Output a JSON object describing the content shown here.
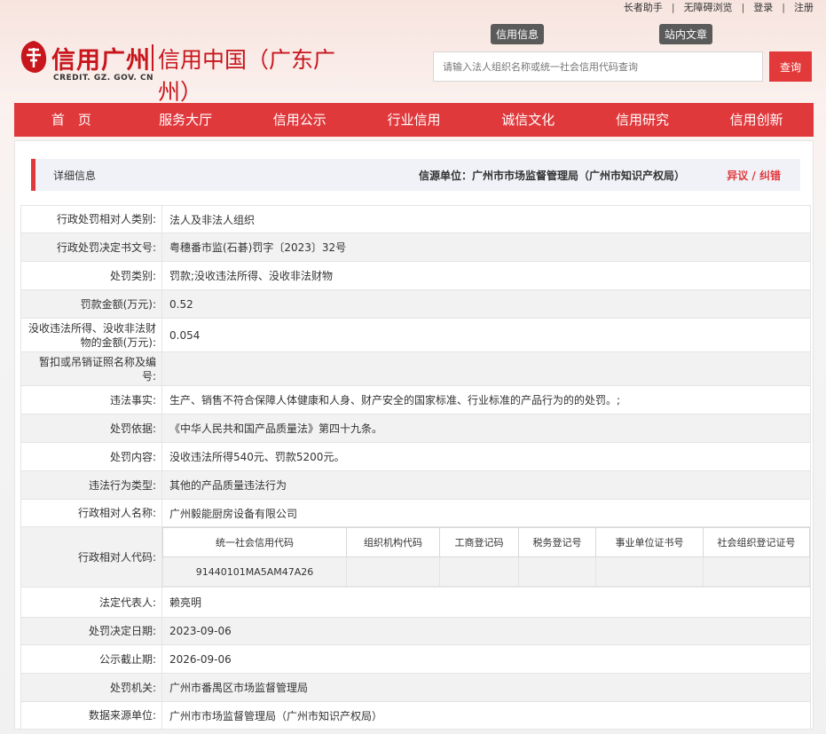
{
  "top_links": [
    "长者助手",
    "无障碍浏览",
    "登录",
    "注册"
  ],
  "logo": {
    "title": "信用广州",
    "subtitle": "信用中国（广东广州）",
    "domain": "CREDIT. GZ. GOV. CN"
  },
  "search": {
    "tab_info": "信用信息",
    "tab_articles": "站内文章",
    "placeholder": "请输入法人组织名称或统一社会信用代码查询",
    "button": "查询"
  },
  "nav": [
    "首　页",
    "服务大厅",
    "信用公示",
    "行业信用",
    "诚信文化",
    "信用研究",
    "信用创新"
  ],
  "detail": {
    "title": "详细信息",
    "source": "信源单位：广州市市场监督管理局（广州市知识产权局）",
    "dispute": "异议 / 纠错"
  },
  "rows": [
    {
      "label": "行政处罚相对人类别:",
      "value": "法人及非法人组织"
    },
    {
      "label": "行政处罚决定书文号:",
      "value": "粤穗番市监(石碁)罚字〔2023〕32号"
    },
    {
      "label": "处罚类别:",
      "value": "罚款;没收违法所得、没收非法财物"
    },
    {
      "label": "罚款金额(万元):",
      "value": "0.52"
    },
    {
      "label": "没收违法所得、没收非法财物的金额(万元):",
      "value": "0.054"
    },
    {
      "label": "暂扣或吊销证照名称及编号:",
      "value": ""
    },
    {
      "label": "违法事实:",
      "value": "生产、销售不符合保障人体健康和人身、财产安全的国家标准、行业标准的产品行为的的处罚。;"
    },
    {
      "label": "处罚依据:",
      "value": "《中华人民共和国产品质量法》第四十九条。"
    },
    {
      "label": "处罚内容:",
      "value": "没收违法所得540元、罚款5200元。"
    },
    {
      "label": "违法行为类型:",
      "value": "其他的产品质量违法行为"
    },
    {
      "label": "行政相对人名称:",
      "value": "广州毅能厨房设备有限公司"
    }
  ],
  "codes": {
    "label": "行政相对人代码:",
    "headers": [
      "统一社会信用代码",
      "组织机构代码",
      "工商登记码",
      "税务登记号",
      "事业单位证书号",
      "社会组织登记证号"
    ],
    "values": [
      "91440101MA5AM47A26",
      "",
      "",
      "",
      "",
      ""
    ]
  },
  "rows_after": [
    {
      "label": "法定代表人:",
      "value": "赖亮明"
    },
    {
      "label": "处罚决定日期:",
      "value": "2023-09-06"
    },
    {
      "label": "公示截止期:",
      "value": "2026-09-06"
    },
    {
      "label": "处罚机关:",
      "value": "广州市番禺区市场监督管理局"
    },
    {
      "label": "数据来源单位:",
      "value": "广州市市场监督管理局（广州市知识产权局）"
    }
  ],
  "colors": {
    "brand_red": "#c8161d",
    "nav_red": "#e0393c"
  }
}
